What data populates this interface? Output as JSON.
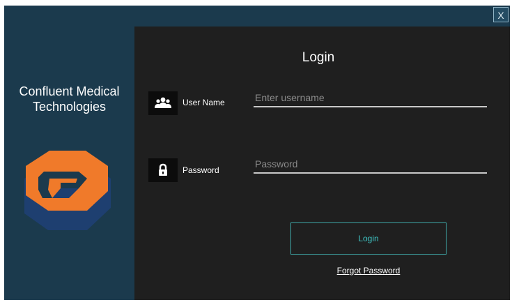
{
  "window": {
    "close_label": "X"
  },
  "brand": {
    "name": "Confluent Medical Technologies",
    "logo_colors": {
      "primary": "#f07a2a",
      "secondary": "#1e3f70"
    }
  },
  "login": {
    "title": "Login",
    "username": {
      "label": "User Name",
      "placeholder": "Enter username",
      "value": "",
      "icon": "users-icon"
    },
    "password": {
      "label": "Password",
      "placeholder": "Password",
      "value": "",
      "icon": "lock-icon"
    },
    "submit_label": "Login",
    "forgot_label": "Forgot Password"
  },
  "colors": {
    "sidebar_bg": "#1b3a4d",
    "panel_bg": "#1f1f1f",
    "accent": "#3fc6c6"
  }
}
